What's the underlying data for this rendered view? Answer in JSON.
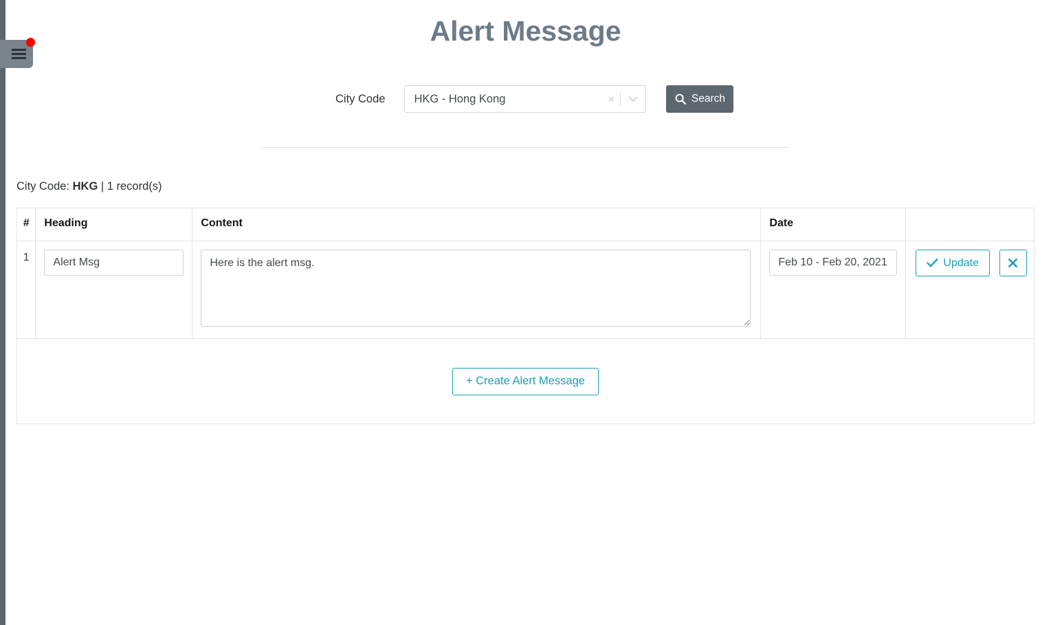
{
  "window": {
    "title": "Alert Message"
  },
  "nav": {
    "menu_button_label": "Menu",
    "menu_icon": "hamburger-icon",
    "notification_badge": ""
  },
  "search": {
    "city_code_label": "City Code",
    "select_value": "HKG - Hong Kong",
    "select_placeholder": "Select...",
    "clear_glyph": "×",
    "dropdown_icon": "chevron-down-icon",
    "clear_icon": "clear-icon",
    "search_button_label": "Search",
    "search_icon": "search-icon"
  },
  "results": {
    "summary_prefix": "City Code: ",
    "summary_code": "HKG",
    "summary_suffix": " | 1 record(s)"
  },
  "table": {
    "columns": [
      "#",
      "Heading",
      "Content",
      "Date",
      ""
    ],
    "rows": [
      {
        "index": "1",
        "heading": "Alert Msg",
        "heading_placeholder": "Heading",
        "content": "Here is the alert msg.",
        "content_placeholder": "Content",
        "date": "Feb 10 - Feb 20, 2021",
        "date_placeholder": "Select date range",
        "update_label": "Update",
        "update_icon": "check-icon",
        "delete_label": "✕",
        "delete_icon": "close-icon"
      }
    ],
    "create_button_label": "+ Create Alert Message"
  },
  "colors": {
    "accent_teal": "#1b9fb5",
    "title_gray": "#6d7b88",
    "button_dark": "#5d6770",
    "rail_dark": "#5d666e",
    "badge_red": "#ff0000"
  }
}
